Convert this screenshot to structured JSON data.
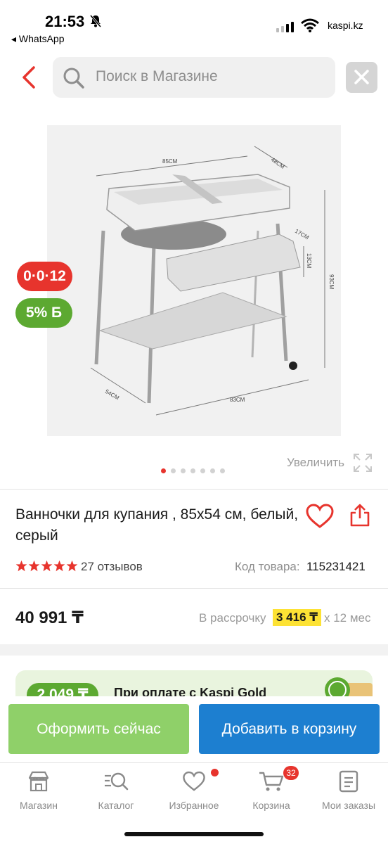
{
  "status_bar": {
    "time": "21:53",
    "back_app": "◂ WhatsApp",
    "domain": "kaspi.kz"
  },
  "search": {
    "placeholder": "Поиск в Магазине"
  },
  "product": {
    "badge_installment": "0·0·12",
    "badge_bonus": "5% Б",
    "image_dims": {
      "top_width": "85CM",
      "depth": "48CM",
      "tray_depth": "17CM",
      "tray_height": "13CM",
      "height": "93CM",
      "base_depth": "54CM",
      "base_width": "83CM"
    },
    "gallery_count": 7,
    "gallery_active": 0,
    "zoom_label": "Увеличить",
    "title": "Ванночки для купания , 85x54 см, белый, серый",
    "rating": 5,
    "reviews": "27 отзывов",
    "code_label": "Код товара:",
    "code": "115231421",
    "price": "40 991 ₸",
    "installment_label": "В рассрочку",
    "installment_amount": "3 416 ₸",
    "installment_term": "x 12 мес"
  },
  "promo": {
    "amount": "2 049 ₸",
    "text": "При оплате с Kaspi Gold"
  },
  "actions": {
    "checkout": "Оформить сейчас",
    "add_to_cart": "Добавить в корзину"
  },
  "tabs": [
    {
      "label": "Магазин",
      "icon": "shop-icon"
    },
    {
      "label": "Каталог",
      "icon": "catalog-search-icon"
    },
    {
      "label": "Избранное",
      "icon": "heart-icon"
    },
    {
      "label": "Корзина",
      "icon": "cart-icon",
      "badge": "32"
    },
    {
      "label": "Мои заказы",
      "icon": "orders-icon"
    }
  ],
  "colors": {
    "kaspi_red": "#e7342d",
    "bonus_green": "#5ca931",
    "checkout_green": "#8fd069",
    "cart_blue": "#1d7fd0",
    "installment_yellow": "#fde234"
  }
}
